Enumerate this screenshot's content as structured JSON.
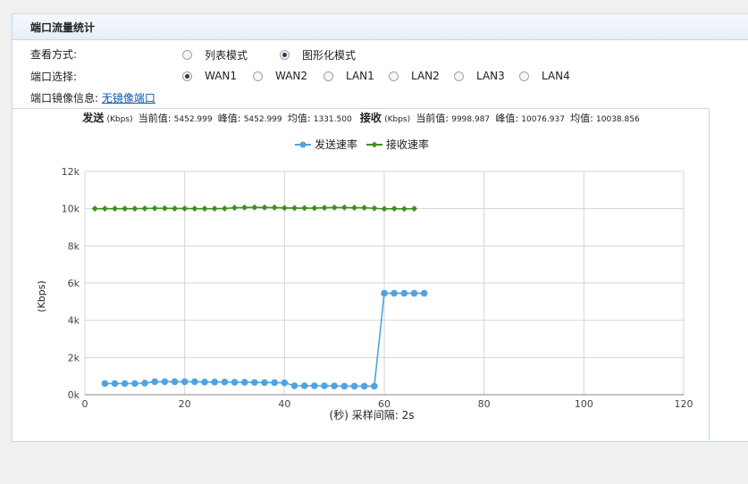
{
  "header": {
    "title": "端口流量统计"
  },
  "view_mode": {
    "label": "查看方式:",
    "options": [
      {
        "label": "列表模式",
        "checked": false
      },
      {
        "label": "图形化模式",
        "checked": true
      }
    ]
  },
  "port_select": {
    "label": "端口选择:",
    "options": [
      {
        "label": "WAN1",
        "checked": true
      },
      {
        "label": "WAN2",
        "checked": false
      },
      {
        "label": "LAN1",
        "checked": false
      },
      {
        "label": "LAN2",
        "checked": false
      },
      {
        "label": "LAN3",
        "checked": false
      },
      {
        "label": "LAN4",
        "checked": false
      }
    ]
  },
  "mirror": {
    "label": "端口镜像信息:",
    "link": "无镜像端口"
  },
  "stats": {
    "send_label": "发送",
    "recv_label": "接收",
    "unit": "(Kbps)",
    "current_label": "当前值:",
    "peak_label": "峰值:",
    "avg_label": "均值:",
    "send_current": "5452.999",
    "send_peak": "5452.999",
    "send_avg": "1331.500",
    "recv_current": "9998.987",
    "recv_peak": "10076.937",
    "recv_avg": "10038.856"
  },
  "colors": {
    "send": "#4fa3e0",
    "recv": "#3f8f1f",
    "grid": "#d6d6d6"
  },
  "chart_data": {
    "type": "line",
    "xlabel": "(秒) 采样间隔: 2s",
    "ylabel": "(Kbps)",
    "xlim": [
      0,
      120
    ],
    "ylim": [
      0,
      12000
    ],
    "x_ticks": [
      0,
      20,
      40,
      60,
      80,
      100,
      120
    ],
    "y_ticks": [
      0,
      2000,
      4000,
      6000,
      8000,
      10000,
      12000
    ],
    "y_tick_labels": [
      "0k",
      "2k",
      "4k",
      "6k",
      "8k",
      "10k",
      "12k"
    ],
    "legend": [
      "发送速率",
      "接收速率"
    ],
    "grid": true,
    "legend_position": "top-center",
    "series": [
      {
        "name": "发送速率",
        "x": [
          4,
          6,
          8,
          10,
          12,
          14,
          16,
          18,
          20,
          22,
          24,
          26,
          28,
          30,
          32,
          34,
          36,
          38,
          40,
          42,
          44,
          46,
          48,
          50,
          52,
          54,
          56,
          58,
          60,
          62,
          64,
          66,
          68
        ],
        "y": [
          600,
          600,
          600,
          600,
          620,
          700,
          700,
          700,
          700,
          700,
          680,
          680,
          680,
          670,
          670,
          660,
          650,
          650,
          640,
          480,
          480,
          480,
          480,
          470,
          460,
          460,
          460,
          460,
          5450,
          5450,
          5450,
          5450,
          5450
        ]
      },
      {
        "name": "接收速率",
        "x": [
          2,
          4,
          6,
          8,
          10,
          12,
          14,
          16,
          18,
          20,
          22,
          24,
          26,
          28,
          30,
          32,
          34,
          36,
          38,
          40,
          42,
          44,
          46,
          48,
          50,
          52,
          54,
          56,
          58,
          60,
          62,
          64,
          66
        ],
        "y": [
          10000,
          10000,
          10000,
          10000,
          10000,
          10010,
          10020,
          10020,
          10010,
          10010,
          10000,
          10000,
          10000,
          10010,
          10050,
          10060,
          10070,
          10060,
          10060,
          10040,
          10030,
          10030,
          10030,
          10050,
          10060,
          10060,
          10050,
          10050,
          10020,
          9990,
          10000,
          9990,
          10000
        ]
      }
    ]
  }
}
